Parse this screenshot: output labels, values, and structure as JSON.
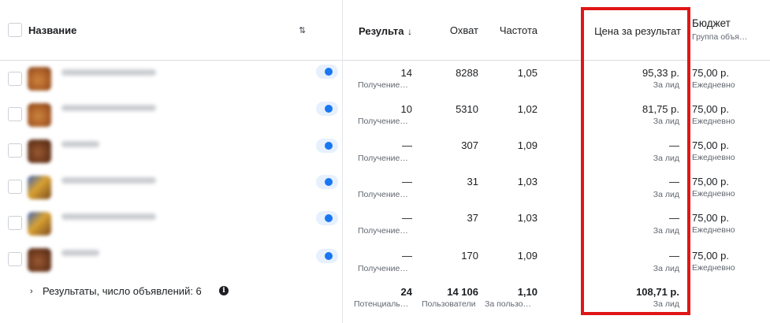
{
  "header": {
    "name_label": "Название",
    "results_label": "Результа",
    "reach_label": "Охват",
    "frequency_label": "Частота",
    "cost_per_result_label": "Цена за результат",
    "budget_label": "Бюджет",
    "budget_sub": "Группа объя…"
  },
  "rows": [
    {
      "results": "14",
      "results_sub": "Получение…",
      "reach": "8288",
      "frequency": "1,05",
      "cost": "95,33 р.",
      "cost_sub": "За лид",
      "budget": "75,00 р.",
      "budget_sub": "Ежедневно"
    },
    {
      "results": "10",
      "results_sub": "Получение…",
      "reach": "5310",
      "frequency": "1,02",
      "cost": "81,75 р.",
      "cost_sub": "За лид",
      "budget": "75,00 р.",
      "budget_sub": "Ежедневно"
    },
    {
      "results": "—",
      "results_sub": "Получение…",
      "reach": "307",
      "frequency": "1,09",
      "cost": "—",
      "cost_sub": "За лид",
      "budget": "75,00 р.",
      "budget_sub": "Ежедневно"
    },
    {
      "results": "—",
      "results_sub": "Получение…",
      "reach": "31",
      "frequency": "1,03",
      "cost": "—",
      "cost_sub": "За лид",
      "budget": "75,00 р.",
      "budget_sub": "Ежедневно"
    },
    {
      "results": "—",
      "results_sub": "Получение…",
      "reach": "37",
      "frequency": "1,03",
      "cost": "—",
      "cost_sub": "За лид",
      "budget": "75,00 р.",
      "budget_sub": "Ежедневно"
    },
    {
      "results": "—",
      "results_sub": "Получение…",
      "reach": "170",
      "frequency": "1,09",
      "cost": "—",
      "cost_sub": "За лид",
      "budget": "75,00 р.",
      "budget_sub": "Ежедневно"
    }
  ],
  "footer": {
    "label": "Результаты, число объявлений: 6",
    "results": "24",
    "results_sub": "Потенциаль…",
    "reach": "14 106",
    "reach_sub": "Пользователи",
    "frequency": "1,10",
    "frequency_sub": "За пользо…",
    "cost": "108,71 р.",
    "cost_sub": "За лид"
  },
  "icons": {
    "sort": "up-down-arrows-icon",
    "sort_desc": "arrow-down-icon",
    "chevron": "chevron-right-icon",
    "info": "info-icon"
  },
  "colors": {
    "toggle_on": "#1877f2",
    "highlight_border": "#e01616"
  }
}
